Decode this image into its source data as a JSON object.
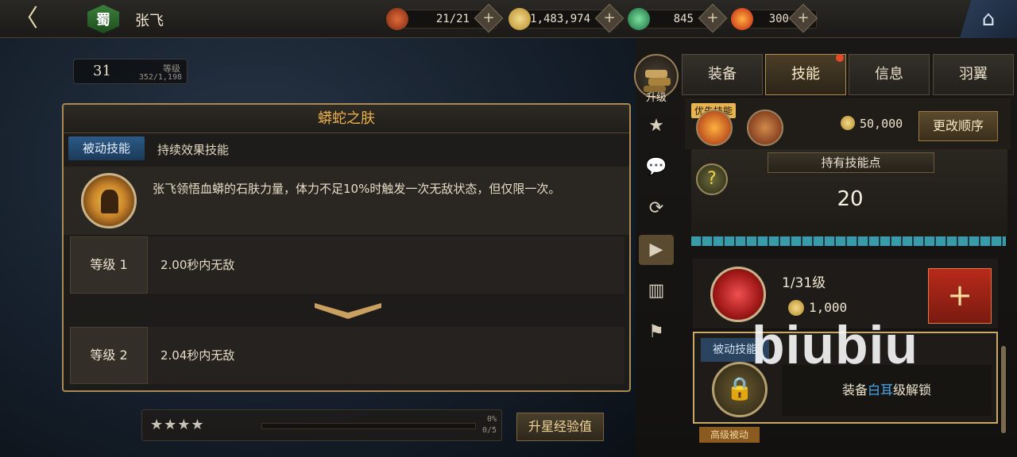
{
  "header": {
    "back_glyph": "〈",
    "faction": "蜀",
    "hero_name": "张飞",
    "stamina": "21/21",
    "gold": "1,483,974",
    "jade": "845",
    "gem": "300",
    "home_glyph": "⌂"
  },
  "level": {
    "value": "31",
    "label": "等级",
    "exp": "352/1,198"
  },
  "skill_detail": {
    "title": "蟒蛇之肤",
    "type_badge": "被动技能",
    "type_desc": "持续效果技能",
    "description": "张飞领悟血蟒的石肤力量，体力不足10%时触发一次无敌状态，但仅限一次。",
    "levels": [
      {
        "label": "等级 1",
        "value": "2.00秒内无敌"
      },
      {
        "label": "等级 2",
        "value": "2.04秒内无敌"
      }
    ]
  },
  "star_bar": {
    "stars": "★★★★",
    "percent": "0%",
    "count": "0/5",
    "button": "升星经验值"
  },
  "side_menu": {
    "upgrade_label": "升级",
    "items": [
      "star-icon",
      "chat-icon",
      "swap-icon",
      "play-icon",
      "ranking-icon",
      "formation-icon"
    ]
  },
  "tabs": [
    "装备",
    "技能",
    "信息",
    "羽翼"
  ],
  "skills_panel": {
    "priority_label": "优先技能",
    "gold_cost": "50,000",
    "reorder_button": "更改顺序",
    "skill_points_title": "持有技能点",
    "skill_points_value": "20",
    "entry_level": "1/31级",
    "entry_cost": "1,000",
    "entry_add": "+",
    "locked_badge": "被动技能",
    "unlock_text_pre": "装备",
    "unlock_text_hl": "白耳",
    "unlock_text_post": "级解锁",
    "next_strip": "高级被动"
  },
  "watermark": "biubiu",
  "colors": {
    "accent_gold": "#ecb24a",
    "passive_blue": "#2c5a86",
    "add_red": "#b82a1a"
  }
}
